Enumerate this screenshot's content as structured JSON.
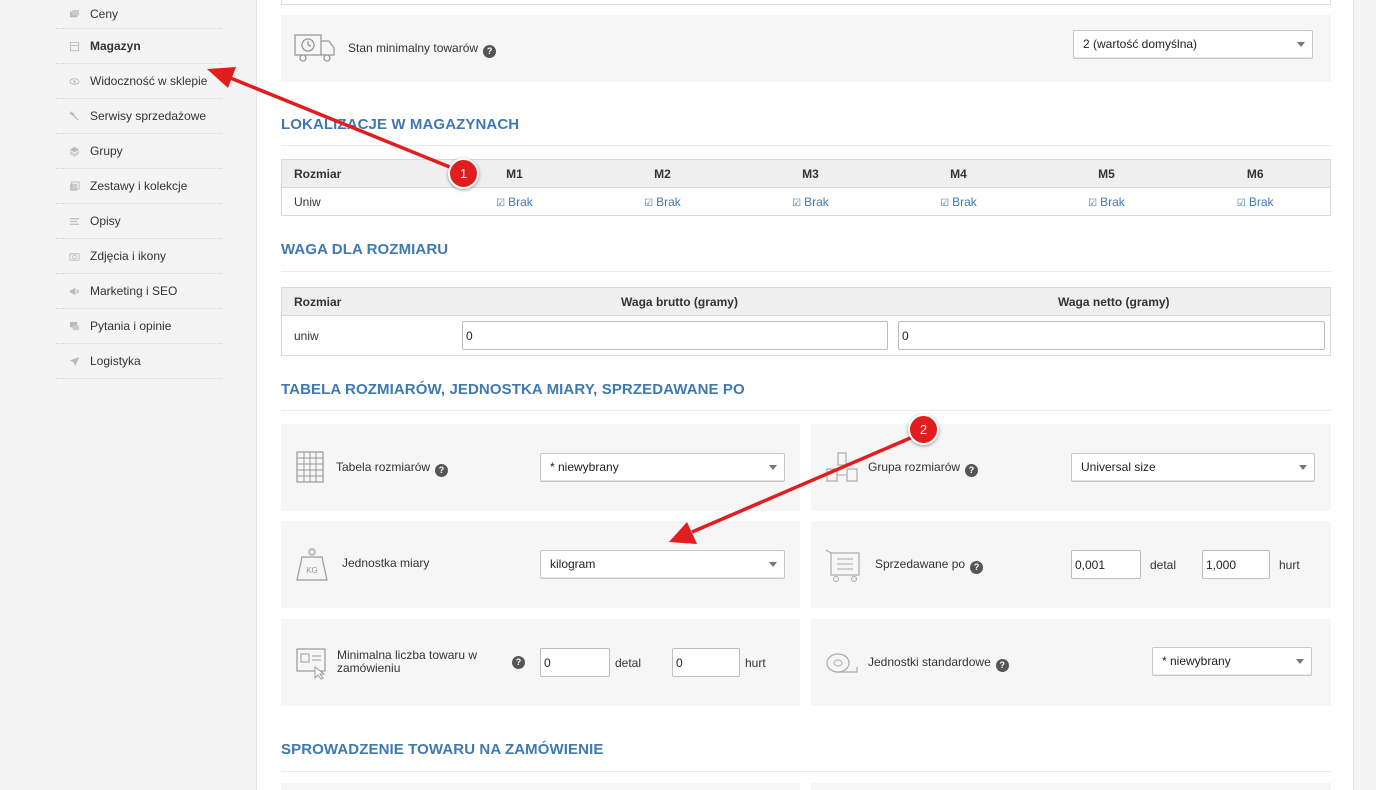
{
  "sidebar": {
    "items": [
      {
        "label": "Ceny",
        "icon": "tags-icon"
      },
      {
        "label": "Magazyn",
        "icon": "box-icon"
      },
      {
        "label": "Widoczność w sklepie",
        "icon": "eye-icon"
      },
      {
        "label": "Serwisy sprzedażowe",
        "icon": "hammer-icon"
      },
      {
        "label": "Grupy",
        "icon": "layers-icon"
      },
      {
        "label": "Zestawy i kolekcje",
        "icon": "collection-icon"
      },
      {
        "label": "Opisy",
        "icon": "lines-icon"
      },
      {
        "label": "Zdjęcia i ikony",
        "icon": "camera-icon"
      },
      {
        "label": "Marketing i SEO",
        "icon": "megaphone-icon"
      },
      {
        "label": "Pytania i opinie",
        "icon": "chat-icon"
      },
      {
        "label": "Logistyka",
        "icon": "paper-plane-icon"
      }
    ]
  },
  "stock": {
    "label": "Stan minimalny towarów",
    "help": "?",
    "select": "2 (wartość domyślna)"
  },
  "locations": {
    "title": "LOKALIZACJE W MAGAZYNACH",
    "headers": [
      "Rozmiar",
      "M1",
      "M2",
      "M3",
      "M4",
      "M5",
      "M6"
    ],
    "row_label": "Uniw",
    "cells": [
      "Brak",
      "Brak",
      "Brak",
      "Brak",
      "Brak",
      "Brak"
    ]
  },
  "weight": {
    "title": "WAGA DLA ROZMIARU",
    "headers": [
      "Rozmiar",
      "Waga brutto (gramy)",
      "Waga netto (gramy)"
    ],
    "row_label": "uniw",
    "gross": "0",
    "net": "0"
  },
  "sizes": {
    "title": "TABELA ROZMIARÓW, JEDNOSTKA MIARY, SPRZEDAWANE PO",
    "size_table": {
      "label": "Tabela rozmiarów",
      "value": "* niewybrany"
    },
    "size_group": {
      "label": "Grupa rozmiarów",
      "value": "Universal size"
    },
    "unit": {
      "label": "Jednostka miary",
      "value": "kilogram"
    },
    "sold_by": {
      "label": "Sprzedawane po",
      "retail_value": "0,001",
      "retail_label": "detal",
      "wholesale_value": "1,000",
      "wholesale_label": "hurt"
    },
    "min_order": {
      "label": "Minimalna liczba towaru w zamówieniu",
      "retail_value": "0",
      "retail_label": "detal",
      "wholesale_value": "0",
      "wholesale_label": "hurt"
    },
    "std_units": {
      "label": "Jednostki standardowe",
      "value": "* niewybrany"
    }
  },
  "verification": {
    "title": "SPROWADZENIE TOWARU NA ZAMÓWIENIE"
  },
  "annotations": {
    "badge1": "1",
    "badge2": "2",
    "color": "#e11d1d"
  }
}
